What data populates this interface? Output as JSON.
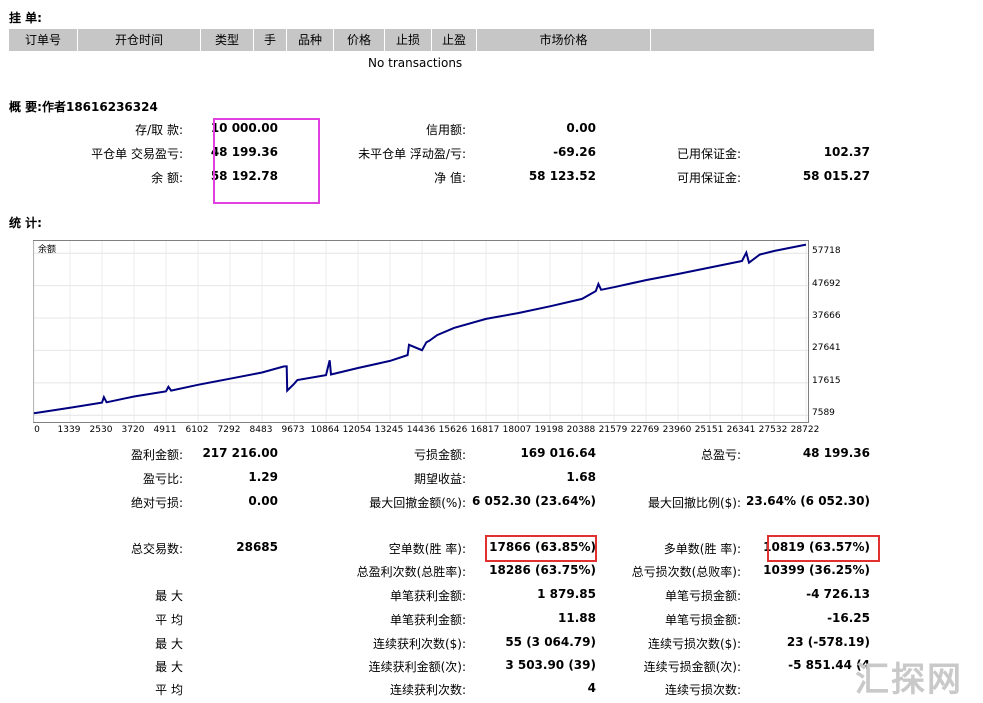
{
  "pending": {
    "title": "挂 单:",
    "columns": [
      "订单号",
      "开仓时间",
      "类型",
      "手",
      "品种",
      "价格",
      "止损",
      "止盈",
      "市场价格",
      ""
    ],
    "empty": "No transactions"
  },
  "summary": {
    "title": "概 要:作者18616236324",
    "rows": [
      [
        {
          "label": "存/取 款:",
          "value": "10 000.00"
        },
        {
          "label": "信用额:",
          "value": "0.00"
        },
        {
          "label": "",
          "value": ""
        }
      ],
      [
        {
          "label": "平仓单 交易盈亏:",
          "value": "48 199.36"
        },
        {
          "label": "未平仓单 浮动盈/亏:",
          "value": "-69.26"
        },
        {
          "label": "已用保证金:",
          "value": "102.37"
        }
      ],
      [
        {
          "label": "余 额:",
          "value": "58 192.78"
        },
        {
          "label": "净 值:",
          "value": "58 123.52"
        },
        {
          "label": "可用保证金:",
          "value": "58 015.27"
        }
      ]
    ]
  },
  "stats": {
    "title": "统 计:",
    "block1": [
      [
        {
          "label": "盈利金额:",
          "value": "217 216.00"
        },
        {
          "label": "亏损金额:",
          "value": "169 016.64"
        },
        {
          "label": "总盈亏:",
          "value": "48 199.36"
        }
      ],
      [
        {
          "label": "盈亏比:",
          "value": "1.29"
        },
        {
          "label": "期望收益:",
          "value": "1.68"
        },
        {
          "label": "",
          "value": ""
        }
      ],
      [
        {
          "label": "绝对亏损:",
          "value": "0.00"
        },
        {
          "label": "最大回撤金额(%):",
          "value": "6 052.30 (23.64%)"
        },
        {
          "label": "最大回撤比例($):",
          "value": "23.64% (6 052.30)"
        }
      ]
    ],
    "block2": [
      [
        {
          "label": "总交易数:",
          "value": "28685"
        },
        {
          "label": "空单数(胜 率):",
          "value": "17866 (63.85%)"
        },
        {
          "label": "多单数(胜 率):",
          "value": "10819 (63.57%)"
        }
      ],
      [
        {
          "label": "",
          "value": ""
        },
        {
          "label": "总盈利次数(总胜率):",
          "value": "18286 (63.75%)"
        },
        {
          "label": "总亏损次数(总败率):",
          "value": "10399 (36.25%)"
        }
      ],
      [
        {
          "label": "最 大",
          "value": ""
        },
        {
          "label": "单笔获利金额:",
          "value": "1 879.85"
        },
        {
          "label": "单笔亏损金额:",
          "value": "-4 726.13"
        }
      ],
      [
        {
          "label": "平 均",
          "value": ""
        },
        {
          "label": "单笔获利金额:",
          "value": "11.88"
        },
        {
          "label": "单笔亏损金额:",
          "value": "-16.25"
        }
      ],
      [
        {
          "label": "最 大",
          "value": ""
        },
        {
          "label": "连续获利次数($):",
          "value": "55 (3 064.79)"
        },
        {
          "label": "连续亏损次数($):",
          "value": "23 (-578.19)"
        }
      ],
      [
        {
          "label": "最 大",
          "value": ""
        },
        {
          "label": "连续获利金额(次):",
          "value": "3 503.90 (39)"
        },
        {
          "label": "连续亏损金额(次):",
          "value": "-5 851.44 (4"
        }
      ],
      [
        {
          "label": "平 均",
          "value": ""
        },
        {
          "label": "连续获利次数:",
          "value": "4"
        },
        {
          "label": "连续亏损次数:",
          "value": ""
        }
      ]
    ]
  },
  "watermark": "汇探网",
  "chart_data": {
    "type": "line",
    "title": "余额",
    "xlabel": "",
    "ylabel": "",
    "x_ticks": [
      0,
      1339,
      2530,
      3720,
      4911,
      6102,
      7292,
      8483,
      9673,
      10864,
      12054,
      13245,
      14436,
      15626,
      16817,
      18007,
      19198,
      20388,
      21579,
      22769,
      23960,
      25151,
      26341,
      27532,
      28722
    ],
    "y_ticks": [
      7589,
      17615,
      27641,
      37666,
      47692,
      57718
    ],
    "xlim": [
      0,
      28722
    ],
    "ylim": [
      5500,
      61500
    ],
    "line_color": "#000080",
    "series": [
      {
        "name": "",
        "x": [
          0,
          1339,
          2530,
          2600,
          2700,
          3720,
          4911,
          5000,
          5100,
          6102,
          7292,
          8483,
          9300,
          9400,
          9420,
          9673,
          9800,
          10864,
          11000,
          11050,
          12054,
          13245,
          13900,
          13950,
          14436,
          14600,
          14700,
          15000,
          15626,
          16817,
          18007,
          19198,
          20388,
          20900,
          21000,
          21100,
          21579,
          22769,
          23960,
          25151,
          26341,
          26500,
          26600,
          27000,
          27532,
          28722
        ],
        "y": [
          8200,
          9900,
          11500,
          13200,
          11600,
          13400,
          15000,
          16400,
          15200,
          17000,
          18900,
          20800,
          22700,
          22700,
          15200,
          17300,
          18500,
          20000,
          24600,
          20200,
          22200,
          24400,
          26200,
          29400,
          27700,
          30200,
          30600,
          32400,
          34600,
          37400,
          39200,
          41300,
          43600,
          46000,
          48200,
          46400,
          47200,
          49400,
          51300,
          53300,
          55300,
          57900,
          54800,
          57300,
          58400,
          60400
        ]
      }
    ]
  }
}
